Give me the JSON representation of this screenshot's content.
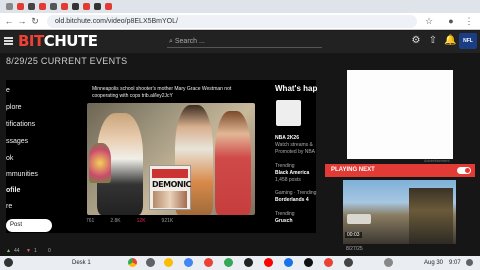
{
  "browser": {
    "url": "old.bitchute.com/video/p8ELX5BmYOL/"
  },
  "header": {
    "logo_left": "BIT",
    "logo_right": "CHUTE",
    "search_placeholder": "Search ..."
  },
  "page": {
    "title": "8/29/25 CURRENT EVENTS"
  },
  "video": {
    "sidemenu": [
      "e",
      "plore",
      "tifications",
      "ssages",
      "ok",
      "mmunities",
      "ofile",
      "re"
    ],
    "post_label": "Post",
    "tweet_text": "Minneapolis school shooter's mother Mary Grace Westman not cooperating with cops trib.al/ley2JcY",
    "overlay_word": "DEMONIC",
    "stats": [
      "761",
      "2.8K",
      "12K",
      "921K"
    ],
    "right_column": {
      "heading": "What's hap",
      "item1_small": "NBA 2K26",
      "item1_text": "Watch streams &",
      "item1_promo": "Promoted by NBA",
      "trend1_label": "Trending",
      "trend1_value": "Black America",
      "trend1_posts": "1,458 posts",
      "trend2_label": "Gaming · Trending",
      "trend2_value": "Borderlands 4",
      "trend3_label": "Trending",
      "trend3_value": "Grusch"
    }
  },
  "sidebar": {
    "advertisement": "Advertisement",
    "playing_next": "PLAYING NEXT",
    "next_duration": "00:03",
    "next_date": "8/27/25"
  },
  "bottom": {
    "counts": [
      "44",
      "1",
      "0"
    ]
  },
  "shelf": {
    "desk_label": "Desk 1",
    "date": "Aug 30",
    "time": "9:07"
  },
  "colors": {
    "accent": "#ef4136",
    "header_bg": "#222222",
    "page_bg": "#161616"
  }
}
